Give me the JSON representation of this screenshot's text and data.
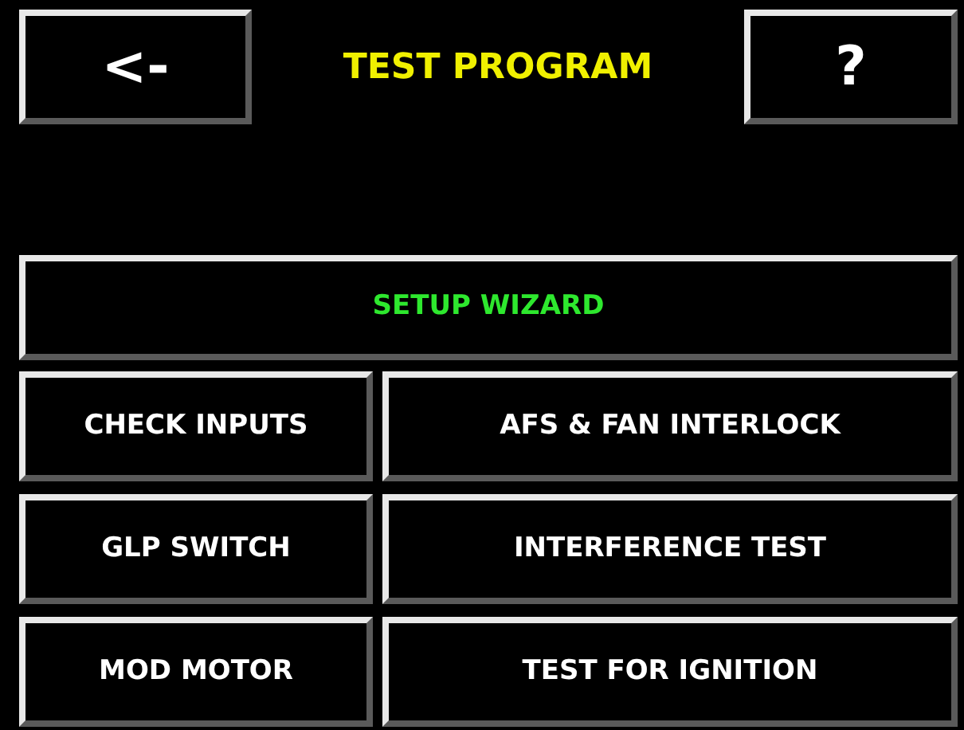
{
  "header": {
    "back_button": "<-",
    "title": "TEST PROGRAM",
    "help_button": "?"
  },
  "wizard_button": "SETUP WIZARD",
  "buttons": [
    {
      "label": "CHECK INPUTS",
      "wide": false
    },
    {
      "label": "AFS & FAN INTERLOCK",
      "wide": true
    },
    {
      "label": "GLP SWITCH",
      "wide": false
    },
    {
      "label": "INTERFERENCE TEST",
      "wide": true
    },
    {
      "label": "MOD MOTOR",
      "wide": false
    },
    {
      "label": "TEST FOR IGNITION",
      "wide": true
    }
  ]
}
